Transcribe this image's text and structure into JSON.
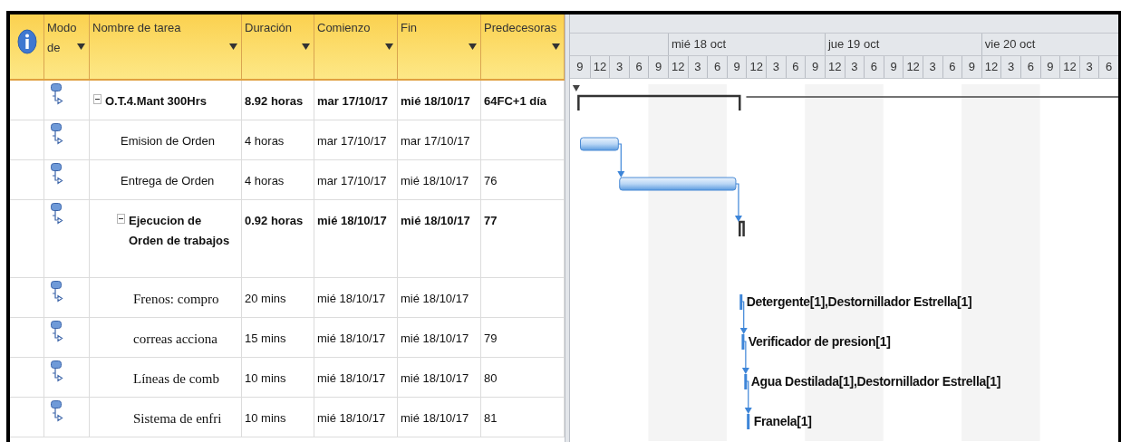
{
  "columns": [
    {
      "label": "Modo de"
    },
    {
      "label": "Nombre de tarea"
    },
    {
      "label": "Duración"
    },
    {
      "label": "Comienzo"
    },
    {
      "label": "Fin"
    },
    {
      "label": "Predecesoras"
    }
  ],
  "tasks": [
    {
      "kind": "summary",
      "expanded": true,
      "name": "O.T.4.Mant 300Hrs",
      "duration": "8.92 horas",
      "start": "mar 17/10/17",
      "finish": "mié 18/10/17",
      "predecessors": "64FC+1 día",
      "children": [
        {
          "kind": "task",
          "name": "Emision de Orden",
          "duration": "4 horas",
          "start": "mar 17/10/17",
          "finish": "mar 17/10/17"
        },
        {
          "kind": "task",
          "name": "Entrega de Orden",
          "duration": "4 horas",
          "start": "mar 17/10/17",
          "finish": "mié 18/10/17",
          "predecessors": "76"
        },
        {
          "kind": "summary",
          "expanded": true,
          "name": "Ejecucion de Orden de trabajos",
          "duration": "0.92 horas",
          "start": "mié 18/10/17",
          "finish": "mié 18/10/17",
          "predecessors": "77",
          "children": [
            {
              "kind": "task",
              "name": "Frenos: compro",
              "duration": "20 mins",
              "start": "mié 18/10/17",
              "finish": "mié 18/10/17",
              "resources": "Detergente[1],Destornillador Estrella[1]"
            },
            {
              "kind": "task",
              "name": "correas acciona",
              "duration": "15 mins",
              "start": "mié 18/10/17",
              "finish": "mié 18/10/17",
              "predecessors": "79",
              "resources": "Verificador de presion[1]"
            },
            {
              "kind": "task",
              "name": "Líneas de comb",
              "duration": "10 mins",
              "start": "mié 18/10/17",
              "finish": "mié 18/10/17",
              "predecessors": "80",
              "resources": "Agua Destilada[1],Destornillador Estrella[1]"
            },
            {
              "kind": "task",
              "name": "Sistema de enfri",
              "duration": "10 mins",
              "start": "mié 18/10/17",
              "finish": "mié 18/10/17",
              "predecessors": "81",
              "resources": "Franela[1]"
            }
          ]
        }
      ]
    }
  ],
  "timescale": {
    "days": [
      {
        "label": "mié 18 oct"
      },
      {
        "label": "jue 19 oct"
      },
      {
        "label": "vie 20 oct"
      }
    ],
    "hours": [
      "9",
      "12",
      "3",
      "6",
      "9",
      "12",
      "3",
      "6",
      "9",
      "12",
      "3",
      "6",
      "9",
      "12",
      "3",
      "6",
      "9",
      "12",
      "3",
      "6",
      "9",
      "12",
      "3",
      "6",
      "9",
      "12",
      "3",
      "6"
    ]
  }
}
